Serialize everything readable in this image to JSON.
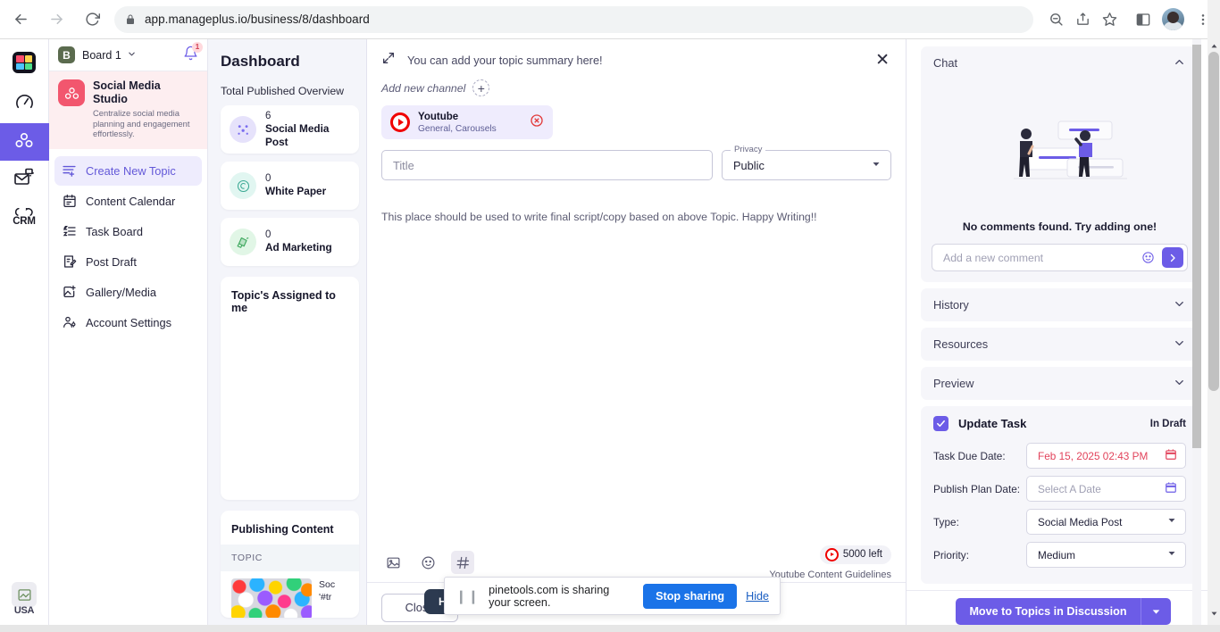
{
  "browser": {
    "url": "app.manageplus.io/business/8/dashboard",
    "back_icon": "back-arrow-icon",
    "forward_icon": "forward-arrow-icon",
    "reload_icon": "reload-icon",
    "lock_icon": "lock-icon",
    "zoom_icon": "zoom-out-icon",
    "share_icon": "share-icon",
    "bookmark_icon": "star-icon",
    "sidepanel_icon": "side-panel-icon",
    "menu_icon": "kebab-menu-icon"
  },
  "rail": {
    "items": [
      {
        "name": "apps-logo",
        "label": ""
      },
      {
        "name": "speedometer",
        "label": ""
      },
      {
        "name": "social-studio",
        "label": ""
      },
      {
        "name": "mail-campaign",
        "label": ""
      },
      {
        "name": "crm",
        "label": "CRM"
      }
    ],
    "bottom_label": "USA"
  },
  "sidebar": {
    "board": {
      "initial": "B",
      "name": "Board 1"
    },
    "notification_count": "1",
    "banner": {
      "title": "Social Media Studio",
      "subtitle": "Centralize social media planning and engagement effortlessly."
    },
    "items": [
      {
        "label": "Create New Topic",
        "icon": "create-topic-icon",
        "active": true
      },
      {
        "label": "Content Calendar",
        "icon": "calendar-icon",
        "active": false
      },
      {
        "label": "Task Board",
        "icon": "task-list-icon",
        "active": false
      },
      {
        "label": "Post Draft",
        "icon": "draft-edit-icon",
        "active": false
      },
      {
        "label": "Gallery/Media",
        "icon": "gallery-add-icon",
        "active": false
      },
      {
        "label": "Account Settings",
        "icon": "account-settings-icon",
        "active": false
      }
    ]
  },
  "dashboard": {
    "title": "Dashboard",
    "subtitle": "Total Published Overview",
    "stats": [
      {
        "count": "6",
        "label": "Social Media Post",
        "icon": "network-nodes-icon",
        "bg": "#e6e2fb",
        "fg": "#7a6df0"
      },
      {
        "count": "0",
        "label": "White Paper",
        "icon": "document-spiral-icon",
        "bg": "#e1f6f1",
        "fg": "#3aa893"
      },
      {
        "count": "0",
        "label": "Ad Marketing",
        "icon": "megaphone-icon",
        "bg": "#e1f6e6",
        "fg": "#3ea85e"
      }
    ],
    "assigned_title": "Topic's Assigned to me",
    "publishing_title": "Publishing Content",
    "publishing_col": "TOPIC",
    "publishing_rows": [
      {
        "line1": "Soc",
        "line2": "'#tr"
      }
    ]
  },
  "modal": {
    "summary_placeholder": "You can add your topic summary here!",
    "expand_icon": "expand-arrows-icon",
    "close_icon": "close-icon",
    "add_channel_label": "Add new channel",
    "add_channel_plus": "+",
    "channel": {
      "name": "Youtube",
      "subtitle": "General, Carousels",
      "logo_icon": "youtube-icon",
      "remove_icon": "remove-circle-icon"
    },
    "title_placeholder": "Title",
    "privacy_legend": "Privacy",
    "privacy_value": "Public",
    "editor_hint": "This place should be used to write final script/copy based on above Topic. Happy Writing!!",
    "toolbar": [
      {
        "name": "image-icon",
        "glyph": "image"
      },
      {
        "name": "emoji-icon",
        "glyph": "emoji"
      },
      {
        "name": "hashtag-icon",
        "glyph": "hash"
      }
    ],
    "tooltip": "HashTag",
    "counter": "5000 left",
    "guidelines": "Youtube Content Guidelines",
    "close_label": "Close"
  },
  "right": {
    "chat": {
      "title": "Chat",
      "empty_text": "No comments found. Try adding one!",
      "comment_placeholder": "Add a new comment",
      "emoji_icon": "emoji-icon",
      "send_icon": "send-arrow-icon"
    },
    "sections": [
      {
        "title": "History",
        "expanded": false
      },
      {
        "title": "Resources",
        "expanded": false
      },
      {
        "title": "Preview",
        "expanded": false
      }
    ],
    "task": {
      "title": "Update Task",
      "status": "In Draft",
      "checked": true,
      "rows": [
        {
          "label": "Task Due Date:",
          "value": "Feb 15, 2025 02:43 PM",
          "style": "red",
          "control": "date",
          "icon": "calendar-red-icon"
        },
        {
          "label": "Publish Plan Date:",
          "value": "Select A Date",
          "style": "placeholder",
          "control": "date",
          "icon": "calendar-icon"
        },
        {
          "label": "Type:",
          "value": "Social Media Post",
          "style": "normal",
          "control": "select",
          "icon": "chevron-down-icon"
        },
        {
          "label": "Priority:",
          "value": "Medium",
          "style": "normal",
          "control": "select",
          "icon": "chevron-down-icon"
        }
      ]
    },
    "footer": {
      "move_label": "Move to Topics in Discussion",
      "caret_icon": "chevron-down-icon"
    }
  },
  "share_toast": {
    "pause_icon": "pause-icon",
    "text": "pinetools.com is sharing your screen.",
    "stop_label": "Stop sharing",
    "hide_label": "Hide"
  },
  "colors": {
    "accent": "#6c5ce7",
    "youtube_red": "#f00000",
    "danger": "#e2435b",
    "chrome_blue": "#1a73e8"
  }
}
